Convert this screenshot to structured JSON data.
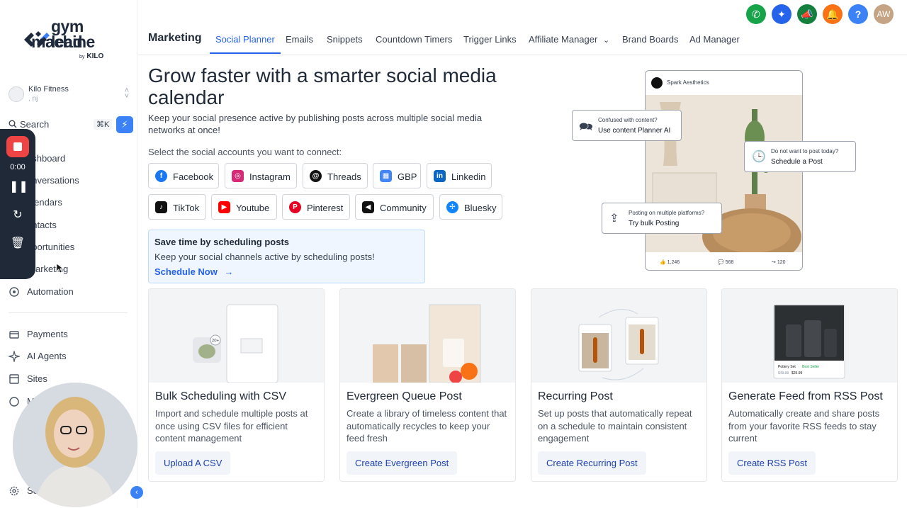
{
  "brand": {
    "line1": "gym lead",
    "line2": "machine",
    "by": "by",
    "by_brand": "KILO"
  },
  "account": {
    "name": "Kilo Fitness",
    "sub": ", nj"
  },
  "search": {
    "label": "Search",
    "shortcut": "⌘K"
  },
  "recorder": {
    "time": "0:00"
  },
  "sidebar": {
    "items": [
      {
        "label": "ashboard",
        "icon": "dashboard-icon"
      },
      {
        "label": "onversations",
        "icon": "chat-icon"
      },
      {
        "label": "alendars",
        "icon": "calendar-icon"
      },
      {
        "label": "ontacts",
        "icon": "contacts-icon"
      },
      {
        "label": "pportunities",
        "icon": "opportunities-icon"
      },
      {
        "label": "arketing",
        "icon": "marketing-icon"
      },
      {
        "label": "Automation",
        "icon": "automation-icon"
      },
      {
        "label": "Payments",
        "icon": "payments-icon"
      },
      {
        "label": "AI Agents",
        "icon": "ai-agents-icon"
      },
      {
        "label": "Sites",
        "icon": "sites-icon"
      },
      {
        "label": "M",
        "icon": "memberships-icon"
      },
      {
        "label": "Se",
        "icon": "settings-icon"
      }
    ]
  },
  "header": {
    "title": "Marketing",
    "tabs": [
      {
        "label": "Social Planner",
        "active": true
      },
      {
        "label": "Emails"
      },
      {
        "label": "Snippets"
      },
      {
        "label": "Countdown Timers"
      },
      {
        "label": "Trigger Links"
      },
      {
        "label": "Affiliate Manager"
      },
      {
        "label": "Brand Boards"
      },
      {
        "label": "Ad Manager"
      }
    ],
    "avatar_initials": "AW"
  },
  "hero": {
    "title": "Grow faster with a smarter social media calendar",
    "subtitle": "Keep your social presence active by publishing posts across multiple social media networks at once!",
    "select_label": "Select the social accounts you want to connect:"
  },
  "networks": [
    {
      "label": "Facebook",
      "color": "#1877f2"
    },
    {
      "label": "Instagram",
      "color": "#d62976"
    },
    {
      "label": "Threads",
      "color": "#111111"
    },
    {
      "label": "GBP",
      "color": "#4285f4"
    },
    {
      "label": "Linkedin",
      "color": "#0a66c2"
    },
    {
      "label": "TikTok",
      "color": "#111111"
    },
    {
      "label": "Youtube",
      "color": "#ff0000"
    },
    {
      "label": "Pinterest",
      "color": "#e60023"
    },
    {
      "label": "Community",
      "color": "#111111"
    },
    {
      "label": "Bluesky",
      "color": "#1185fe"
    }
  ],
  "tip": {
    "title": "Save time by scheduling posts",
    "body": "Keep your social channels active by scheduling posts!",
    "cta": "Schedule Now"
  },
  "mockup": {
    "account": "Spark Aesthetics",
    "likes": "1,246",
    "comments": "568",
    "shares": "120",
    "bubble1": {
      "q": "Confused with content?",
      "a": "Use content Planner AI"
    },
    "bubble2": {
      "q": "Do not want to post today?",
      "a": "Schedule a Post"
    },
    "bubble3": {
      "q": "Posting on multiple platforms?",
      "a": "Try bulk Posting"
    }
  },
  "cards": [
    {
      "title": "Bulk Scheduling with CSV",
      "desc": "Import and schedule multiple posts at once using CSV files for efficient content management",
      "button": "Upload A CSV",
      "badge": "20+"
    },
    {
      "title": "Evergreen Queue Post",
      "desc": "Create a library of timeless content that automatically recycles to keep your feed fresh",
      "button": "Create Evergreen Post"
    },
    {
      "title": "Recurring Post",
      "desc": "Set up posts that automatically repeat on a schedule to maintain consistent engagement",
      "button": "Create Recurring Post"
    },
    {
      "title": "Generate Feed from RSS Post",
      "desc": "Automatically create and share posts from your favorite RSS feeds to stay current",
      "button": "Create RSS Post",
      "product": "Pottery Set",
      "product_badge": "Best Seller",
      "old_price": "$49.99",
      "price": "$25.99"
    }
  ]
}
